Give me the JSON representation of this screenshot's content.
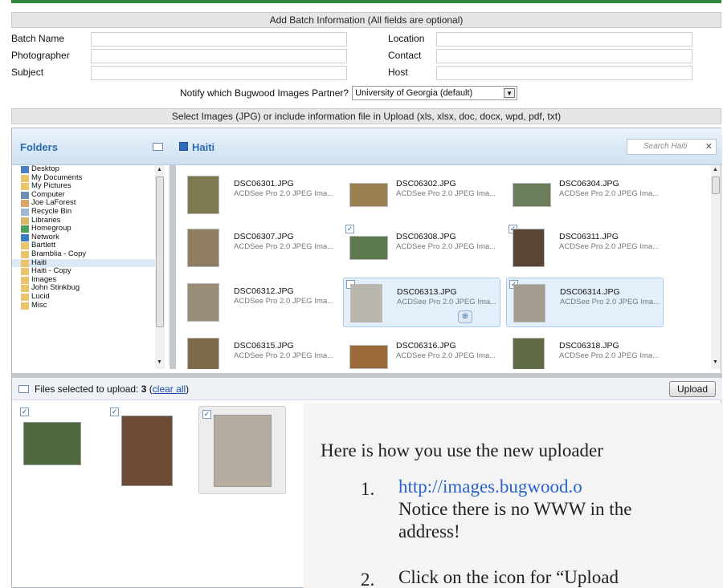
{
  "form": {
    "header": "Add Batch Information (All fields are optional)",
    "left_labels": [
      "Batch Name",
      "Photographer",
      "Subject"
    ],
    "right_labels": [
      "Location",
      "Contact",
      "Host"
    ],
    "notify_label": "Notify which Bugwood Images Partner?",
    "notify_value": "University of Georgia (default)",
    "select_header": "Select Images (JPG) or include information file in Upload (xls, xlsx, doc, docx, wpd, pdf, txt)"
  },
  "uploader": {
    "folders_title": "Folders",
    "current_folder": "Haiti",
    "search_placeholder": "Search Haiti",
    "folders": [
      "Desktop",
      "My Documents",
      "My Pictures",
      "Computer",
      "Joe LaForest",
      "Recycle Bin",
      "Libraries",
      "Homegroup",
      "Network",
      "Bartlett",
      "Bramblia - Copy",
      "Haiti",
      "Haiti - Copy",
      "Images",
      "John Stinkbug",
      "Lucid",
      "Misc"
    ],
    "files": [
      {
        "name": "DSC06301.JPG",
        "type": "ACDSee Pro 2.0 JPEG Ima..."
      },
      {
        "name": "DSC06302.JPG",
        "type": "ACDSee Pro 2.0 JPEG Ima..."
      },
      {
        "name": "DSC06304.JPG",
        "type": "ACDSee Pro 2.0 JPEG Ima..."
      },
      {
        "name": "DSC06307.JPG",
        "type": "ACDSee Pro 2.0 JPEG Ima..."
      },
      {
        "name": "DSC06308.JPG",
        "type": "ACDSee Pro 2.0 JPEG Ima..."
      },
      {
        "name": "DSC06311.JPG",
        "type": "ACDSee Pro 2.0 JPEG Ima..."
      },
      {
        "name": "DSC06312.JPG",
        "type": "ACDSee Pro 2.0 JPEG Ima..."
      },
      {
        "name": "DSC06313.JPG",
        "type": "ACDSee Pro 2.0 JPEG Ima..."
      },
      {
        "name": "DSC06314.JPG",
        "type": "ACDSee Pro 2.0 JPEG Ima..."
      },
      {
        "name": "DSC06315.JPG",
        "type": "ACDSee Pro 2.0 JPEG Ima..."
      },
      {
        "name": "DSC06316.JPG",
        "type": "ACDSee Pro 2.0 JPEG Ima..."
      },
      {
        "name": "DSC06318.JPG",
        "type": "ACDSee Pro 2.0 JPEG Ima..."
      }
    ],
    "files_selected_label": "Files selected to upload:",
    "files_selected_count": "3",
    "clear_all": "clear all",
    "upload_button": "Upload"
  },
  "doc": {
    "intro": "Here is how you use the new uploader",
    "step1_num": "1.",
    "step1_link": "http://images.bugwood.o",
    "step1_line2": "Notice there is no WWW in the",
    "step1_line3": "address!",
    "step2_num": "2.",
    "step2_text": "Click on the icon for “Upload"
  }
}
